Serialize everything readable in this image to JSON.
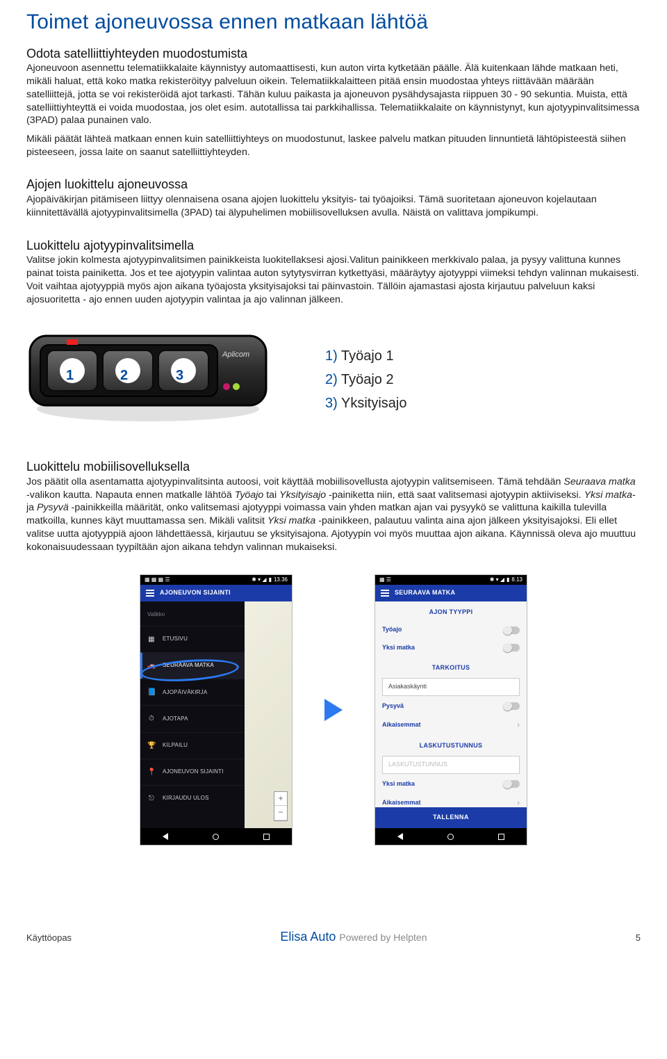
{
  "page": {
    "title": "Toimet ajoneuvossa ennen matkaan lähtöä"
  },
  "sec1": {
    "title": "Odota satelliittiyhteyden muodostumista",
    "p1": "Ajoneuvoon asennettu telematiikkalaite käynnistyy automaattisesti, kun auton virta kytketään päälle. Älä kuitenkaan lähde matkaan heti, mikäli haluat, että koko matka rekisteröityy palveluun oikein. Telematiikkalaitteen pitää ensin muodostaa yhteys riittävään määrään satelliittejä, jotta se voi rekisteröidä ajot tarkasti. Tähän kuluu paikasta ja ajoneuvon pysähdysajasta riippuen 30 - 90 sekuntia. Muista, että satelliittiyhteyttä ei voida muodostaa, jos olet esim. autotallissa tai parkkihallissa. Telematiikkalaite on käynnistynyt, kun ajotyypinvalitsimessa (3PAD) palaa punainen valo.",
    "p2": "Mikäli päätät lähteä matkaan ennen kuin satelliittiyhteys on muodostunut, laskee palvelu matkan pituuden linnuntietä lähtöpisteestä siihen pisteeseen, jossa laite on saanut satelliittiyhteyden."
  },
  "sec2": {
    "title": "Ajojen luokittelu ajoneuvossa",
    "p1": "Ajopäiväkirjan pitämiseen liittyy olennaisena osana ajojen luokittelu yksityis- tai työajoiksi. Tämä suoritetaan ajoneuvon kojelautaan kiinnitettävällä ajotyypinvalitsimella (3PAD) tai älypuhelimen mobiilisovelluksen avulla. Näistä on valittava jompikumpi."
  },
  "sec3": {
    "title": "Luokittelu ajotyypinvalitsimella",
    "p1": "Valitse jokin kolmesta ajotyypinvalitsimen painikkeista luokitellaksesi ajosi.Valitun painikkeen merkkivalo palaa, ja pysyy valittuna kunnes painat toista painiketta. Jos et tee ajotyypin valintaa auton sytytysvirran kytkettyäsi, määräytyy ajotyyppi viimeksi tehdyn valinnan mukaisesti. Voit vaihtaa ajotyyppiä myös ajon aikana työajosta yksityisajoksi tai päinvastoin. Tällöin ajamastasi ajosta kirjautuu palveluun kaksi ajosuoritetta - ajo ennen uuden ajotyypin valintaa ja ajo valinnan jälkeen."
  },
  "legend": {
    "i1_num": "1)",
    "i1_label": "Työajo 1",
    "i2_num": "2)",
    "i2_label": "Työajo 2",
    "i3_num": "3)",
    "i3_label": "Yksityisajo"
  },
  "sec4": {
    "title": "Luokittelu mobiilisovelluksella",
    "p1a": "Jos päätit olla asentamatta ajotyypinvalitsinta autoosi, voit käyttää mobiilisovellusta ajotyypin valitsemiseen. Tämä tehdään ",
    "p1b_em": "Seuraava matka",
    "p1c": " -valikon kautta. Napauta ennen matkalle lähtöä ",
    "p1d_em": "Työajo",
    "p1e": " tai ",
    "p1f_em": "Yksityisajo",
    "p1g": " -painiketta niin, että saat valitsemasi ajotyypin aktiiviseksi. ",
    "p1h_em": "Yksi matka",
    "p1i": "- ja ",
    "p1j_em": "Pysyvä",
    "p1k": " -painikkeilla määrität, onko valitsemasi ajotyyppi voimassa vain yhden matkan ajan vai pysyykö se valittuna kaikilla tulevilla matkoilla, kunnes käyt muuttamassa sen. Mikäli valitsit ",
    "p1l_em": "Yksi matka",
    "p1m": " -painikkeen, palautuu valinta aina ajon jälkeen yksityisajoksi. Eli ellet valitse uutta ajotyyppiä ajoon lähdettäessä, kirjautuu se yksityisajona. Ajotyypin voi myös muuttaa ajon aikana. Käynnissä oleva ajo muuttuu kokonaisuudessaan tyypiltään ajon aikana tehdyn valinnan mukaiseksi."
  },
  "phone1": {
    "time": "13.36",
    "appbar": "AJONEUVON SIJAINTI",
    "drawer_header": "Valikko",
    "items": {
      "etusivu": "ETUSIVU",
      "seuraava": "SEURAAVA MATKA",
      "ajopaivakirja": "AJOPÄIVÄKIRJA",
      "ajotapa": "AJOTAPA",
      "kilpailu": "KILPAILU",
      "sijainti": "AJONEUVON SIJAINTI",
      "kirjaudu": "KIRJAUDU ULOS"
    },
    "zoom_plus": "+",
    "zoom_minus": "−"
  },
  "phone2": {
    "time": "8.13",
    "appbar": "SEURAAVA MATKA",
    "sec_type": "AJON TYYPPI",
    "tyoajo": "Työajo",
    "yksimatka": "Yksi matka",
    "sec_tarkoitus": "TARKOITUS",
    "asiakas": "Asiakaskäynti",
    "pysyva": "Pysyvä",
    "aikaisemmat": "Aikaisemmat",
    "sec_lasku": "LASKUTUSTUNNUS",
    "lasku_ph": "LASKUTUSTUNNUS",
    "yksimatka2": "Yksi matka",
    "aikaisemmat2": "Aikaisemmat",
    "save": "TALLENNA"
  },
  "footer": {
    "left": "Käyttöopas",
    "center_a": "Elisa Auto",
    "center_b": "Powered by Helpten",
    "page": "5"
  },
  "device": {
    "brand": "Aplicom",
    "btn1": "1",
    "btn2": "2",
    "btn3": "3"
  }
}
